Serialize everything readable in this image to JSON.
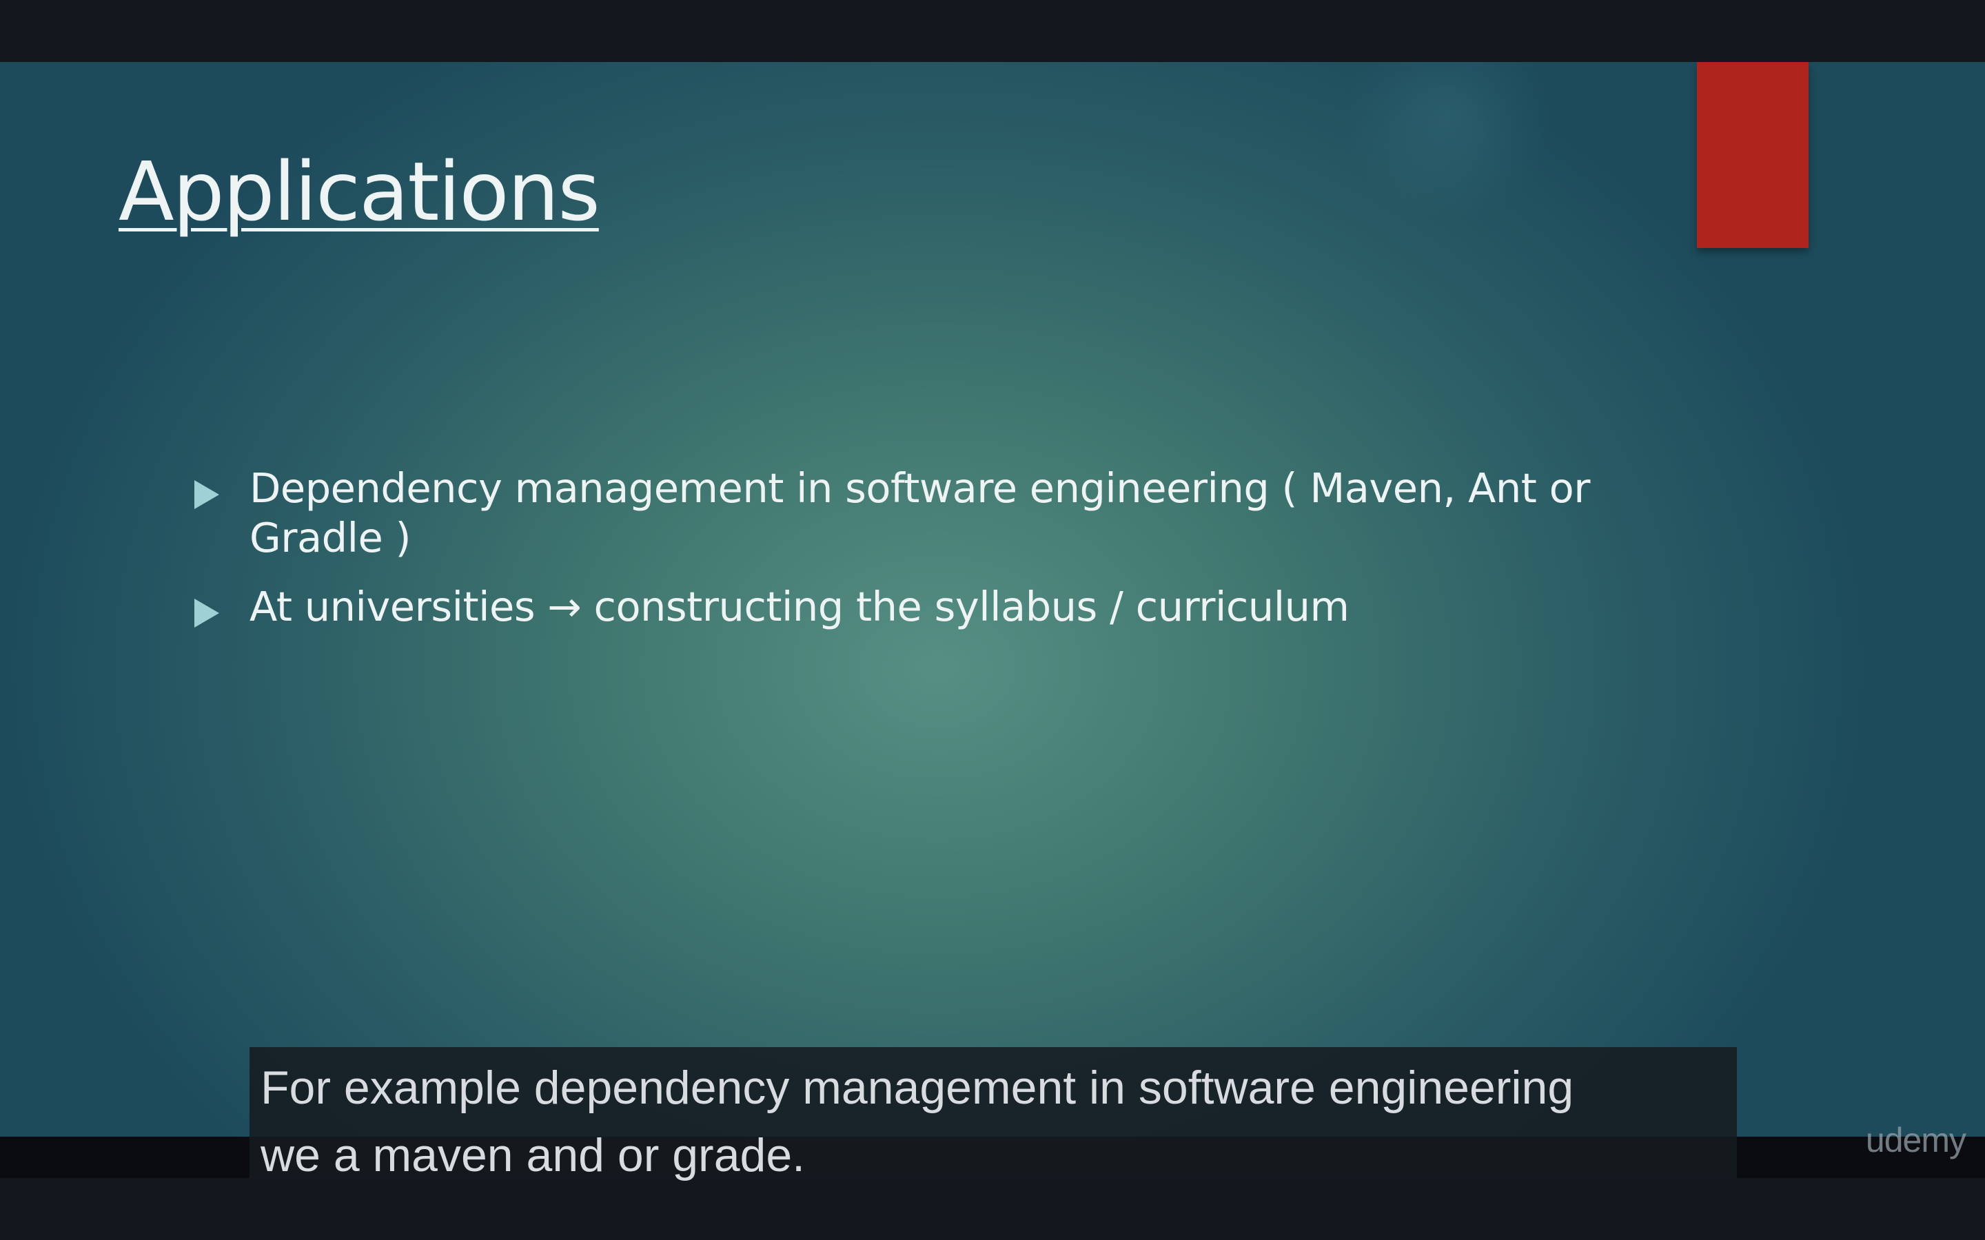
{
  "slide": {
    "title": "Applications",
    "bullets": [
      {
        "line1": "Dependency management in software engineering ( Maven, Ant or",
        "line2": "Gradle )"
      },
      {
        "line1": "At universities → constructing the syllabus / curriculum"
      }
    ],
    "colors": {
      "accent": "#b0241e",
      "bullet": "#9fd0d6",
      "background_center": "#568f84",
      "background_edge": "#1d4b5c"
    }
  },
  "caption": {
    "line1": "For example dependency management in software engineering",
    "line2": "we a maven and or grade."
  },
  "watermark": "udemy"
}
